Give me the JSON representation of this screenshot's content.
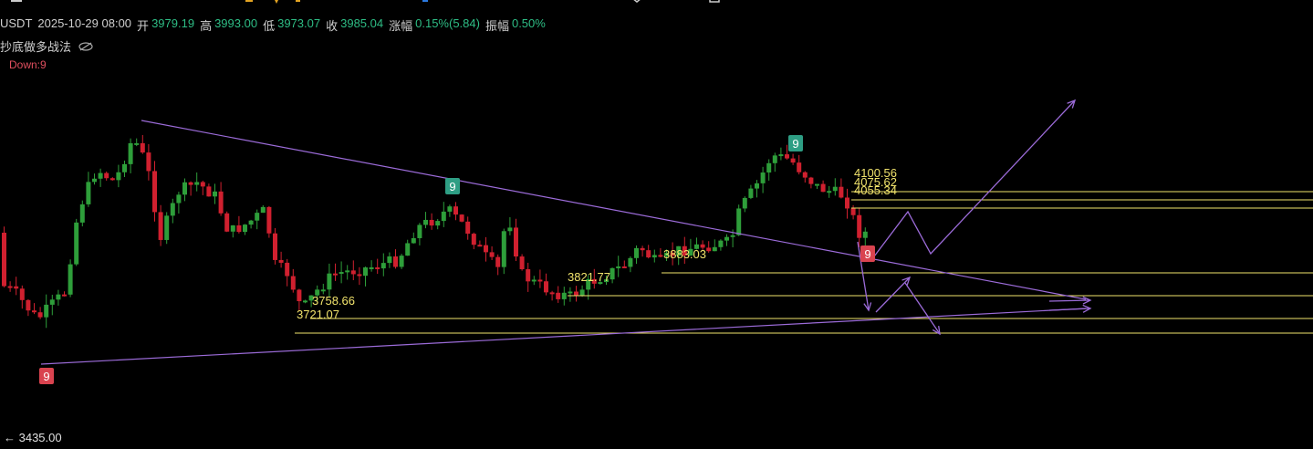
{
  "header": {
    "symbol": "USDT",
    "datetime": "2025-10-29 08:00",
    "open_label": "开",
    "open": "3979.19",
    "high_label": "高",
    "high": "3993.00",
    "low_label": "低",
    "low": "3973.07",
    "close_label": "收",
    "close": "3985.04",
    "change_label": "涨幅",
    "change": "0.15%(5.84)",
    "amplitude_label": "振幅",
    "amplitude": "0.50%"
  },
  "indicator": {
    "name": "抄底做多战法",
    "down_label": "Down:9",
    "icon": "eye-off-icon"
  },
  "bottom_price": "← 3435.00",
  "colors": {
    "up": "#2e9e3a",
    "down": "#d0202f",
    "trendline": "#9b6bd8",
    "level": "#f1e36c",
    "label_text": "#f1e36c",
    "marker_green": "#2e9e84",
    "marker_red": "#d9434f"
  },
  "chart_data": {
    "type": "candlestick",
    "price_levels": [
      {
        "label": "4100.56"
      },
      {
        "label": "4075.62"
      },
      {
        "label": "4055.34"
      },
      {
        "label": "3883.03"
      },
      {
        "label": "3821.77"
      },
      {
        "label": "3758.66"
      },
      {
        "label": "3721.07"
      }
    ],
    "markers": [
      {
        "text": "9",
        "color": "red",
        "position": "below-low-left"
      },
      {
        "text": "9",
        "color": "green",
        "position": "above-mid-high"
      },
      {
        "text": "9",
        "color": "green",
        "position": "above-right-high"
      },
      {
        "text": "9",
        "color": "red",
        "position": "right-current"
      }
    ]
  }
}
